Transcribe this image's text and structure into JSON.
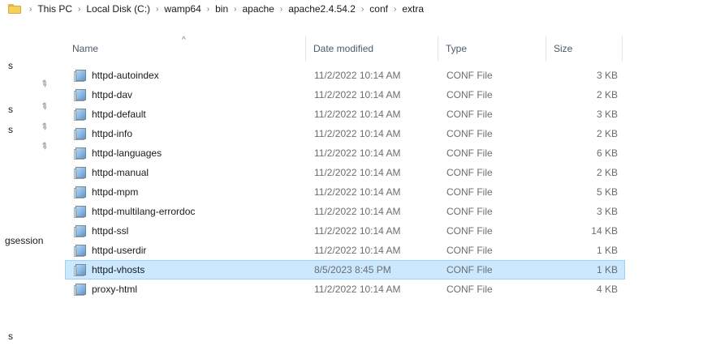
{
  "breadcrumb": [
    "This PC",
    "Local Disk (C:)",
    "wamp64",
    "bin",
    "apache",
    "apache2.4.54.2",
    "conf",
    "extra"
  ],
  "nav": {
    "labels": [
      "s",
      "s",
      "s",
      "gsession",
      "s"
    ]
  },
  "columns": {
    "name": "Name",
    "date": "Date modified",
    "type": "Type",
    "size": "Size"
  },
  "files": [
    {
      "name": "httpd-autoindex",
      "date": "11/2/2022 10:14 AM",
      "type": "CONF File",
      "size": "3 KB",
      "selected": false
    },
    {
      "name": "httpd-dav",
      "date": "11/2/2022 10:14 AM",
      "type": "CONF File",
      "size": "2 KB",
      "selected": false
    },
    {
      "name": "httpd-default",
      "date": "11/2/2022 10:14 AM",
      "type": "CONF File",
      "size": "3 KB",
      "selected": false
    },
    {
      "name": "httpd-info",
      "date": "11/2/2022 10:14 AM",
      "type": "CONF File",
      "size": "2 KB",
      "selected": false
    },
    {
      "name": "httpd-languages",
      "date": "11/2/2022 10:14 AM",
      "type": "CONF File",
      "size": "6 KB",
      "selected": false
    },
    {
      "name": "httpd-manual",
      "date": "11/2/2022 10:14 AM",
      "type": "CONF File",
      "size": "2 KB",
      "selected": false
    },
    {
      "name": "httpd-mpm",
      "date": "11/2/2022 10:14 AM",
      "type": "CONF File",
      "size": "5 KB",
      "selected": false
    },
    {
      "name": "httpd-multilang-errordoc",
      "date": "11/2/2022 10:14 AM",
      "type": "CONF File",
      "size": "3 KB",
      "selected": false
    },
    {
      "name": "httpd-ssl",
      "date": "11/2/2022 10:14 AM",
      "type": "CONF File",
      "size": "14 KB",
      "selected": false
    },
    {
      "name": "httpd-userdir",
      "date": "11/2/2022 10:14 AM",
      "type": "CONF File",
      "size": "1 KB",
      "selected": false
    },
    {
      "name": "httpd-vhosts",
      "date": "8/5/2023 8:45 PM",
      "type": "CONF File",
      "size": "1 KB",
      "selected": true
    },
    {
      "name": "proxy-html",
      "date": "11/2/2022 10:14 AM",
      "type": "CONF File",
      "size": "4 KB",
      "selected": false
    }
  ],
  "colors": {
    "selection_bg": "#cce8ff",
    "selection_border": "#99d1ff",
    "folder": "#f6cf5a"
  },
  "icons": {
    "address_folder": "folder-icon",
    "breadcrumb_separator": "chevron-right-icon",
    "sort_indicator": "sort-up-caret-icon",
    "pin": "pin-icon",
    "file": "conf-file-icon"
  }
}
